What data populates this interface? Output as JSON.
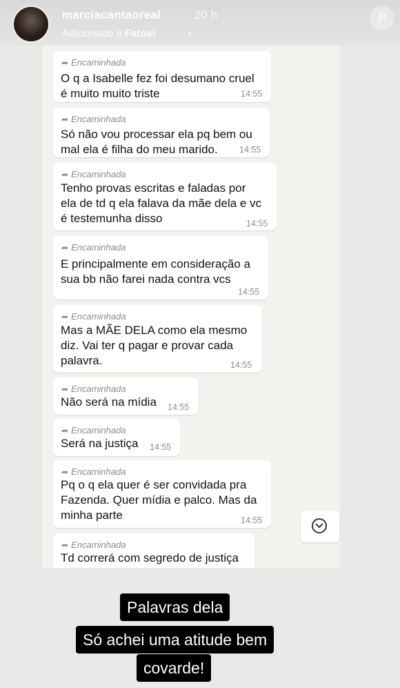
{
  "header": {
    "username": "marciacantaoreal",
    "time_ago": "20 h",
    "added_prefix": "Adicionado a",
    "added_highlight": "Fatos!",
    "chevron": "›",
    "brand_mark": "P"
  },
  "chat": {
    "messages": [
      {
        "forward": "Encaminhada",
        "text": "O q a Isabelle fez foi desumano cruel\né muito muito triste",
        "time": "14:55"
      },
      {
        "forward": "Encaminhada",
        "text": "Só não vou processar ela pq bem ou\nmal ela é filha do meu marido.",
        "time": "14:55"
      },
      {
        "forward": "Encaminhada",
        "text": "Tenho provas escritas e faladas por\nela de td q ela falava da mãe dela e vc\né testemunha disso",
        "time": "14:55"
      },
      {
        "forward": "Encaminhada",
        "text": "E principalmente em consideração a\nsua bb não farei nada contra vcs",
        "time": "14:55"
      },
      {
        "forward": "Encaminhada",
        "text": "Mas a MÃE DELA como ela mesmo\ndiz. Vai ter q pagar e provar cada\npalavra.",
        "time": "14:55"
      },
      {
        "forward": "Encaminhada",
        "text": "Não será na mídia",
        "time": "14:55"
      },
      {
        "forward": "Encaminhada",
        "text": "Será na justiça",
        "time": "14:55"
      },
      {
        "forward": "Encaminhada",
        "text": "Pq o q ela quer é ser convidada pra\nFazenda. Quer mídia e palco. Mas da\nminha parte",
        "time": "14:55"
      },
      {
        "forward": "Encaminhada",
        "text": "Td correrá com segredo de justiça",
        "time": ""
      }
    ]
  },
  "caption": {
    "lines": [
      "Palavras dela",
      "Só achei uma atitude bem",
      "covarde!"
    ]
  }
}
